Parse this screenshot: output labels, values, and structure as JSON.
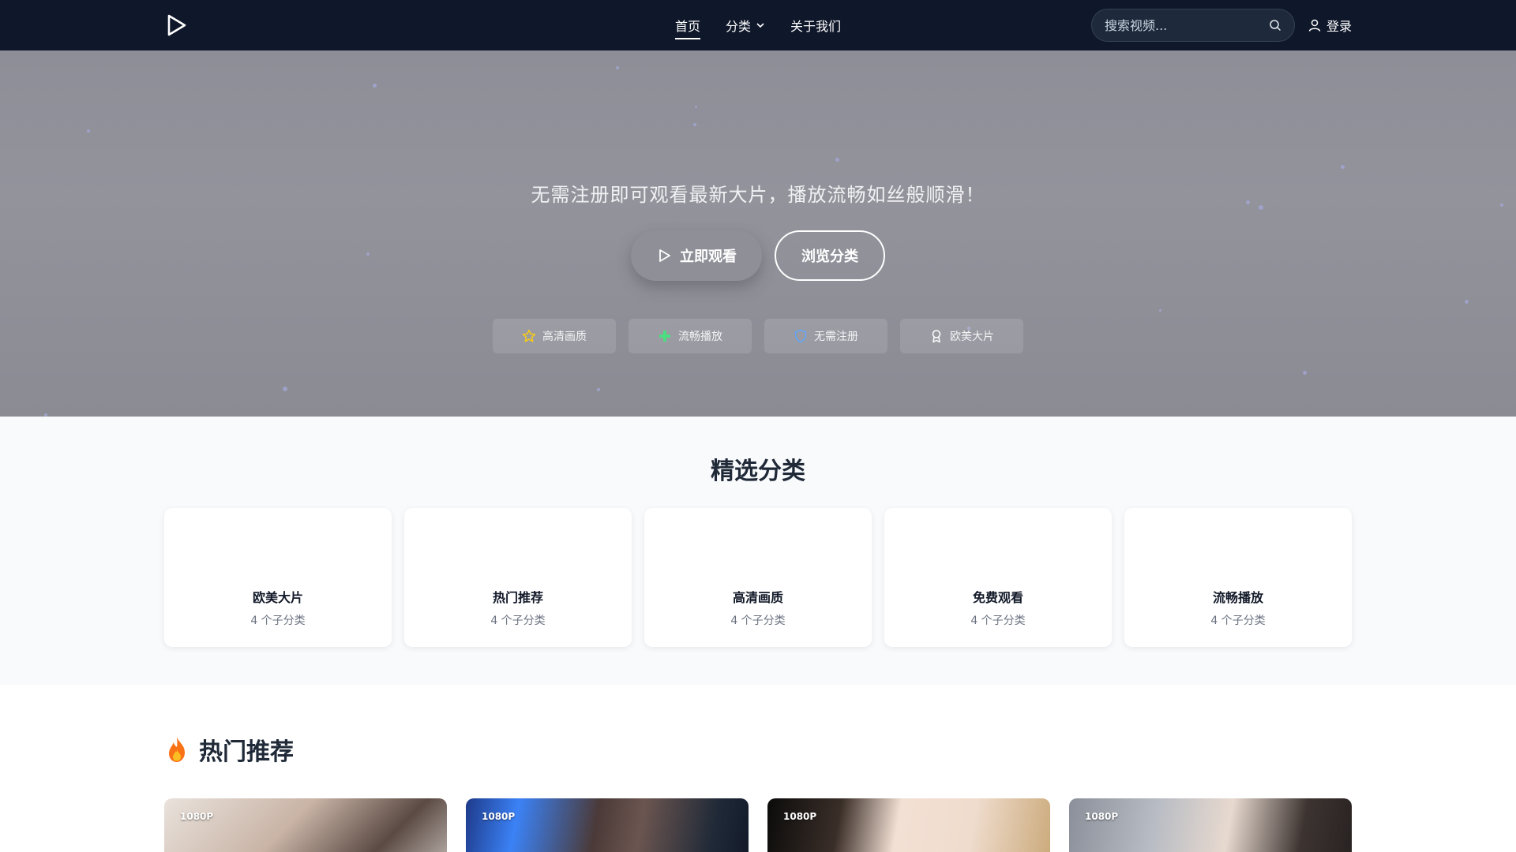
{
  "nav": {
    "links": [
      {
        "label": "首页",
        "active": true
      },
      {
        "label": "分类",
        "dropdown": true
      },
      {
        "label": "关于我们"
      }
    ],
    "search_placeholder": "搜索视频...",
    "login_label": "登录",
    "logo_icon": "play-icon"
  },
  "hero": {
    "subtitle": "无需注册即可观看最新大片，播放流畅如丝般顺滑！",
    "primary_button": "立即观看",
    "secondary_button": "浏览分类",
    "features": [
      {
        "label": "高清画质",
        "icon": "star-icon",
        "color": "#facc15"
      },
      {
        "label": "流畅播放",
        "icon": "plus-icon",
        "color": "#4ade80"
      },
      {
        "label": "无需注册",
        "icon": "shield-icon",
        "color": "#60a5fa"
      },
      {
        "label": "欧美大片",
        "icon": "award-icon",
        "color": "#ffffff"
      }
    ]
  },
  "categories": {
    "title": "精选分类",
    "items": [
      {
        "name": "欧美大片",
        "count": "4 个子分类"
      },
      {
        "name": "热门推荐",
        "count": "4 个子分类"
      },
      {
        "name": "高清画质",
        "count": "4 个子分类"
      },
      {
        "name": "免费观看",
        "count": "4 个子分类"
      },
      {
        "name": "流畅播放",
        "count": "4 个子分类"
      }
    ]
  },
  "hot": {
    "title": "热门推荐",
    "icon": "fire-icon",
    "videos": [
      {
        "badge": "1080P"
      },
      {
        "badge": "1080P"
      },
      {
        "badge": "1080P"
      },
      {
        "badge": "1080P"
      }
    ]
  },
  "colors": {
    "nav_bg": "#0f172a",
    "hero_bg": "#93939c",
    "section_bg": "#f8fafc"
  }
}
